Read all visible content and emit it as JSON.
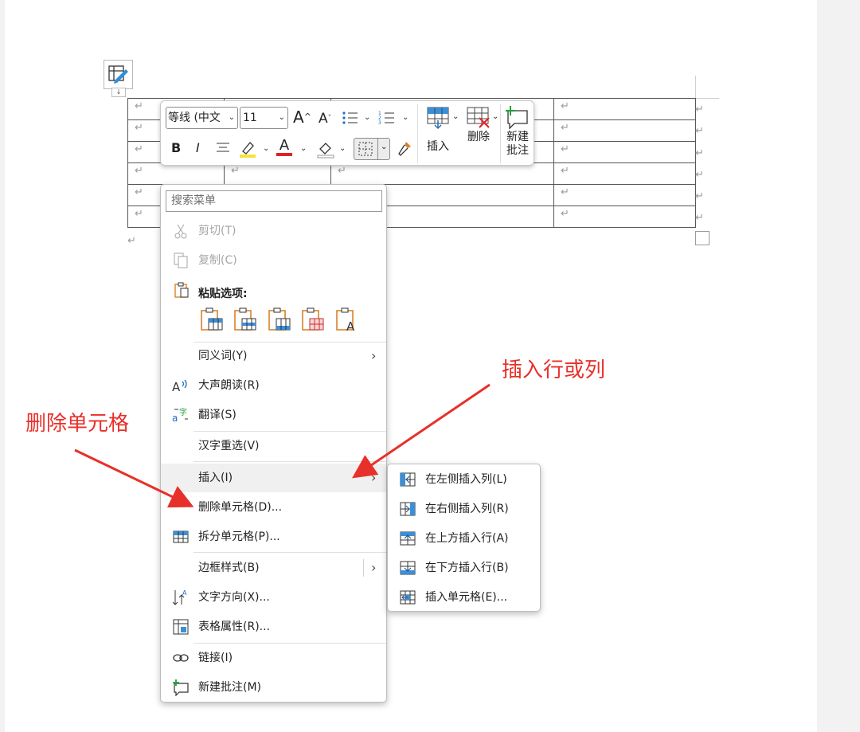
{
  "table": {
    "paragraph_mark": "↵",
    "rows": 6,
    "move_handle_glyph": "↓"
  },
  "mini_toolbar": {
    "font_name": "等线 (中文",
    "font_size": "11",
    "grow_font": "A",
    "shrink_font": "A",
    "bold": "B",
    "italic": "I",
    "font_color_letter": "A",
    "insert_label": "插入",
    "delete_label": "删除",
    "new_comment_line1": "新建",
    "new_comment_line2": "批注",
    "highlight_color": "#f5e33a",
    "font_color": "#e02020"
  },
  "context_menu": {
    "search_placeholder": "搜索菜单",
    "cut": "剪切(T)",
    "copy": "复制(C)",
    "paste_options": "粘贴选项:",
    "synonyms": "同义词(Y)",
    "read_aloud": "大声朗读(R)",
    "translate": "翻译(S)",
    "hanzi_reselect": "汉字重选(V)",
    "insert": "插入(I)",
    "delete_cells": "删除单元格(D)...",
    "split_cells": "拆分单元格(P)...",
    "border_styles": "边框样式(B)",
    "text_direction": "文字方向(X)...",
    "table_properties": "表格属性(R)...",
    "link": "链接(I)",
    "new_comment": "新建批注(M)"
  },
  "insert_submenu": {
    "insert_col_left": "在左侧插入列(L)",
    "insert_col_right": "在右侧插入列(R)",
    "insert_row_above": "在上方插入行(A)",
    "insert_row_below": "在下方插入行(B)",
    "insert_cells": "插入单元格(E)..."
  },
  "annotations": {
    "insert_row_col": "插入行或列",
    "delete_cell": "删除单元格",
    "color": "#e8302a"
  }
}
